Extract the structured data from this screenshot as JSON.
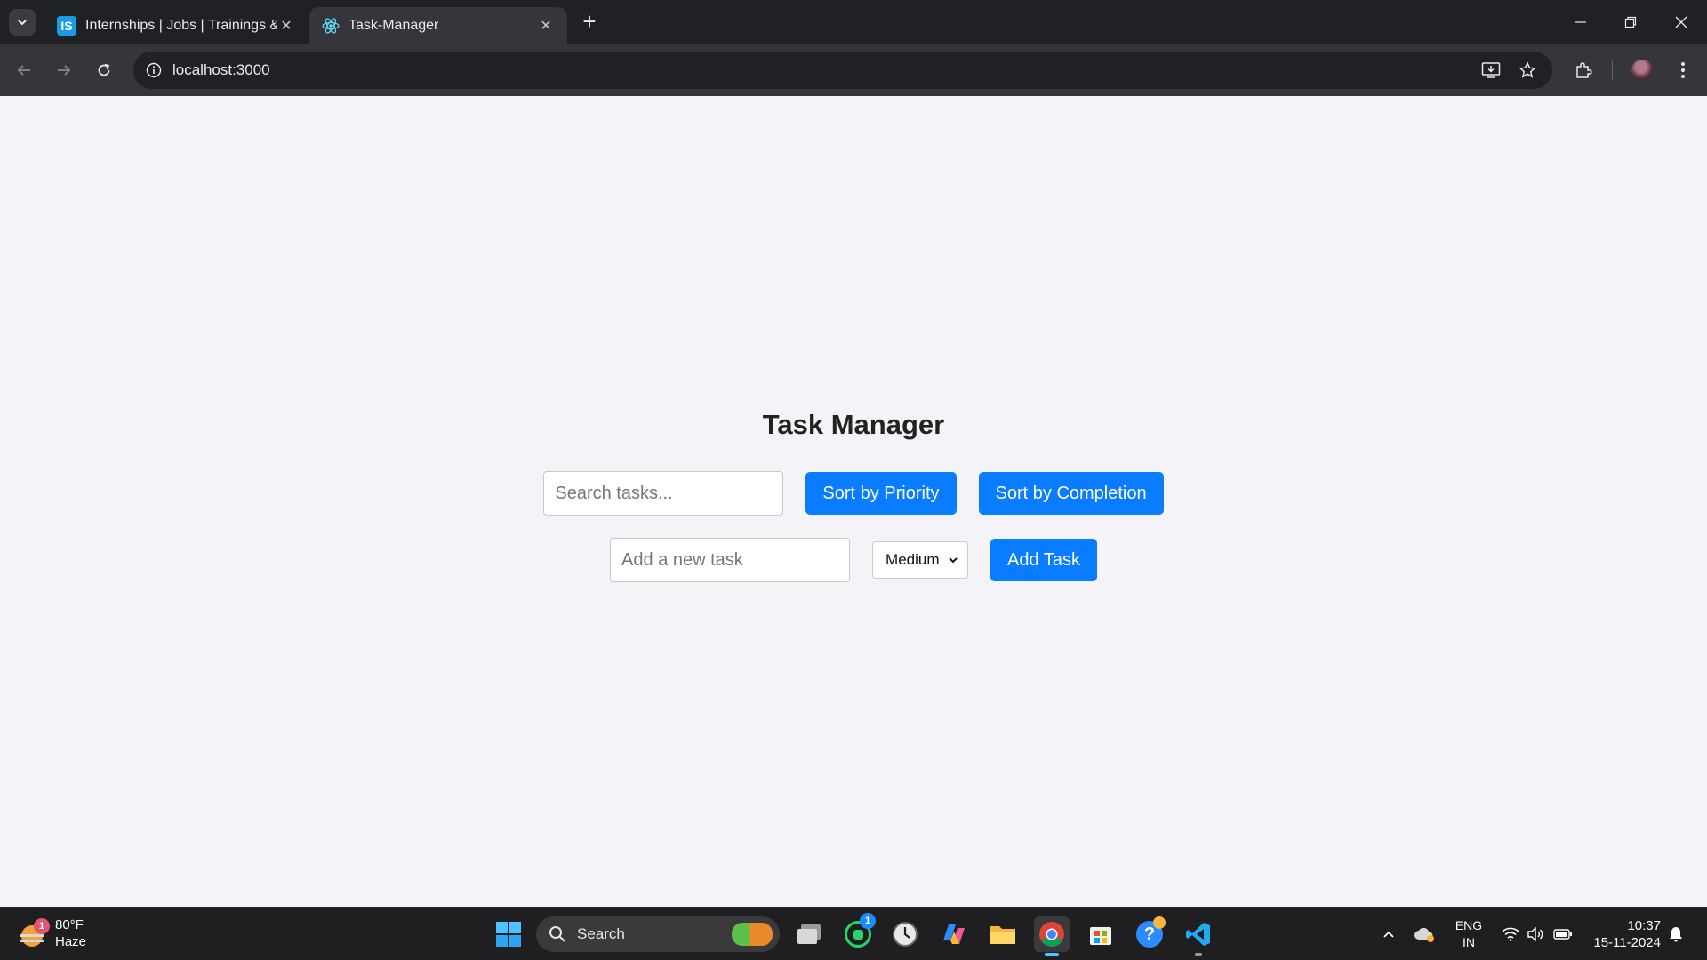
{
  "browser": {
    "tabs": [
      {
        "title": "Internships | Jobs | Trainings & I",
        "favicon": "IS"
      },
      {
        "title": "Task-Manager",
        "favicon": "react-icon"
      }
    ],
    "url": "localhost:3000"
  },
  "app": {
    "title": "Task Manager",
    "search_placeholder": "Search tasks...",
    "sort_priority_label": "Sort by Priority",
    "sort_completion_label": "Sort by Completion",
    "new_task_placeholder": "Add a new task",
    "priority_selected": "Medium",
    "add_task_label": "Add Task",
    "accent_color": "#0a7cff"
  },
  "taskbar": {
    "weather_temp": "80°F",
    "weather_desc": "Haze",
    "weather_badge": "1",
    "search_label": "Search",
    "whatsapp_badge": "1",
    "lang_top": "ENG",
    "lang_bottom": "IN",
    "time": "10:37",
    "date": "15-11-2024"
  }
}
